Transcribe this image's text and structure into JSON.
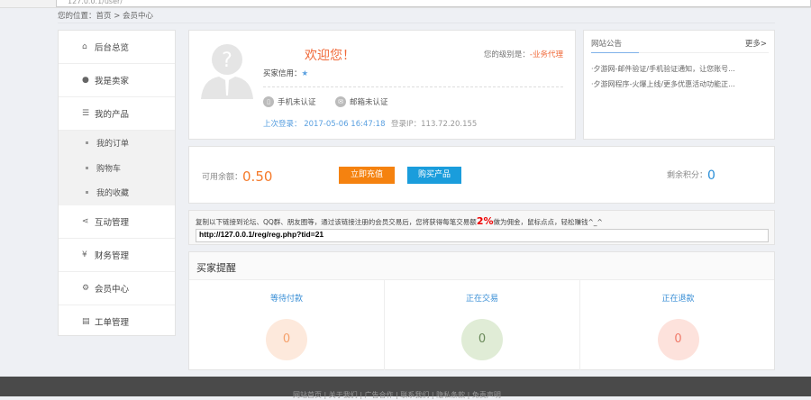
{
  "browser": {
    "address": "127.0.0.1/user/"
  },
  "breadcrumb": "您的位置：首页 > 会员中心",
  "sidebar": {
    "items": [
      {
        "label": "后台总览",
        "icon": "home-icon",
        "glyph": "⌂"
      },
      {
        "label": "我是卖家",
        "icon": "user-icon",
        "glyph": "👤"
      },
      {
        "label": "我的产品",
        "icon": "list-icon",
        "glyph": "☰"
      },
      {
        "label": "互动管理",
        "icon": "share-icon",
        "glyph": "⋖"
      },
      {
        "label": "财务管理",
        "icon": "yen-icon",
        "glyph": "¥"
      },
      {
        "label": "会员中心",
        "icon": "gear-icon",
        "glyph": "⚙"
      },
      {
        "label": "工单管理",
        "icon": "clipboard-icon",
        "glyph": "▤"
      }
    ],
    "sub": [
      "我的订单",
      "购物车",
      "我的收藏"
    ]
  },
  "welcome": {
    "title": "欢迎您！",
    "level_label": "您的级别是：",
    "level": "-业务代理",
    "credit_label": "买家信用：",
    "phone": "手机未认证",
    "email": "邮箱未认证",
    "last_login": "上次登录： 2017-05-06 16:47:18",
    "ip": "登录IP：113.72.20.155"
  },
  "notice": {
    "title": "网站公告",
    "more": "更多>",
    "items": [
      "·夕游网-邮件验证/手机验证通知，让您账号...",
      "·夕游网程序-火爆上线/更多优惠活动功能正..."
    ]
  },
  "balance": {
    "label": "可用余额：",
    "value": "0.50",
    "recharge": "立即充值",
    "buy": "购买产品",
    "points_label": "剩余积分：",
    "points": "0"
  },
  "colors": {
    "recharge": "#f5820f",
    "buy": "#1a9ddc",
    "accent": "#f06a3a"
  },
  "referral": {
    "text_before": "复制以下链接到论坛、QQ群、朋友圈等，通过该链接注册的会员交易后，您将获得每笔交易额",
    "percent": "2%",
    "text_after": "做为佣金，鼠标点点，轻松赚钱^_^",
    "link": "http://127.0.0.1/reg/reg.php?tid=21"
  },
  "remind": {
    "title": "买家提醒",
    "cols": [
      {
        "label": "等待付款",
        "count": "0"
      },
      {
        "label": "正在交易",
        "count": "0"
      },
      {
        "label": "正在退款",
        "count": "0"
      }
    ]
  },
  "footer": "网站首页 | 关于我们 | 广告合作 | 联系我们 | 隐私条款 | 免责声明"
}
